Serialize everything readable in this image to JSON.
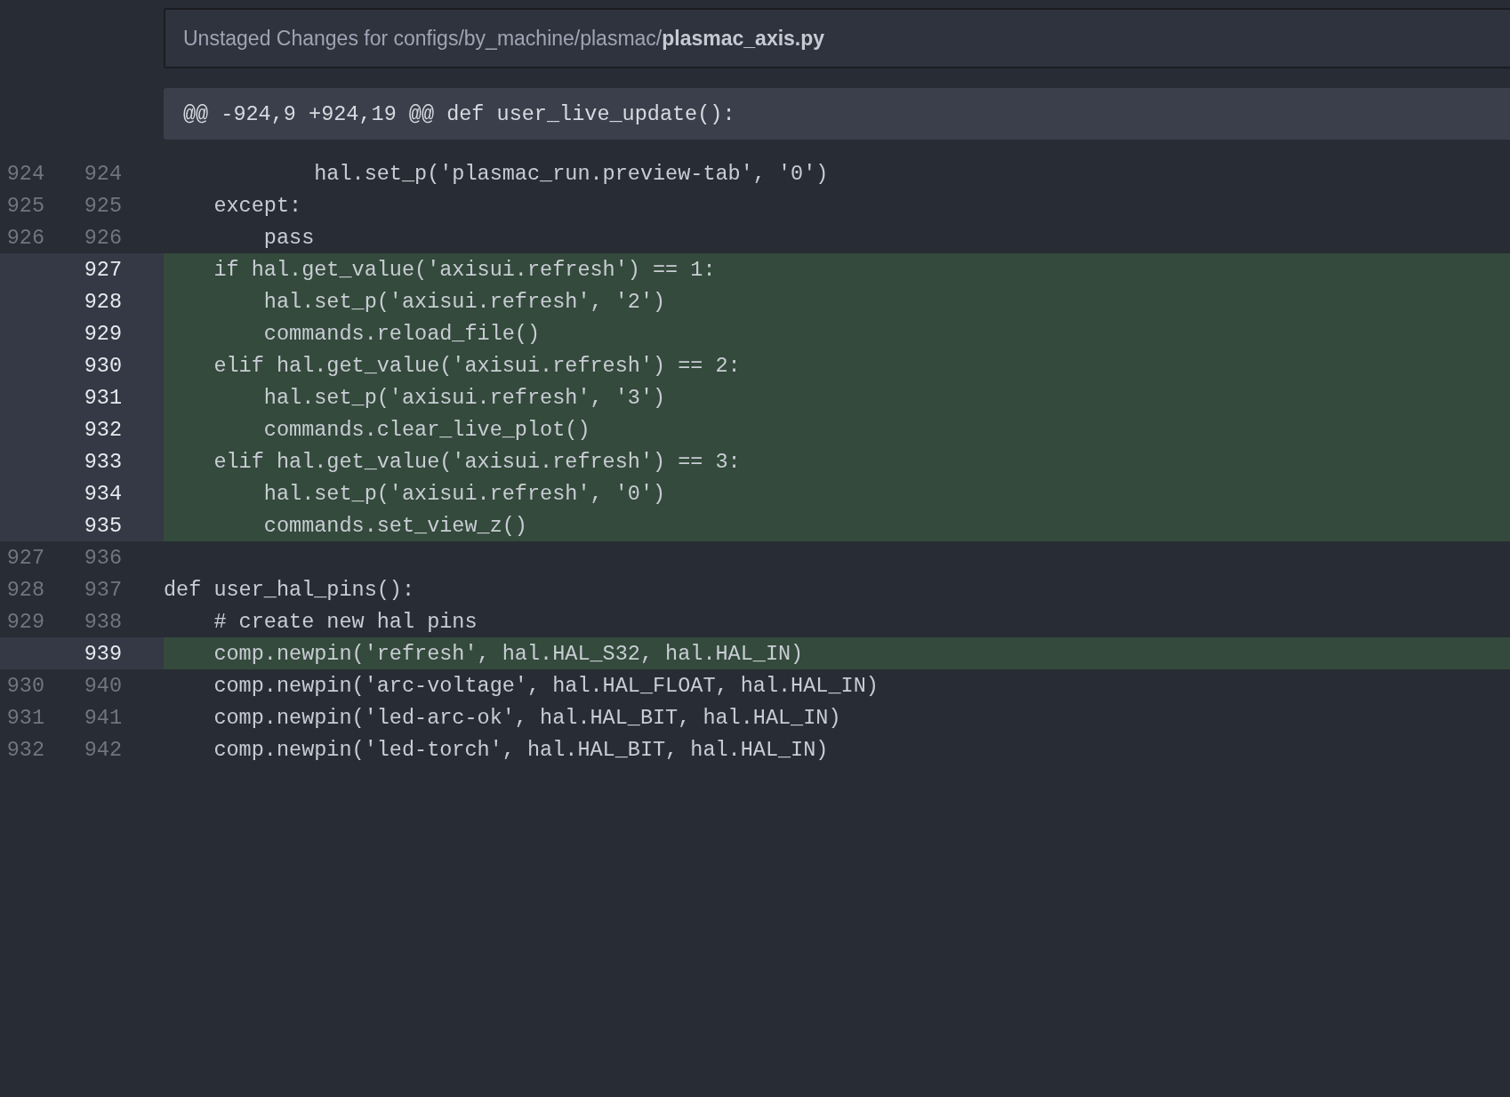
{
  "header": {
    "prefix": "Unstaged Changes for configs/by_machine/plasmac/",
    "filename": "plasmac_axis.py"
  },
  "hunk_header": "@@ -924,9 +924,19 @@ def user_live_update():",
  "lines": [
    {
      "kind": "context",
      "old": "924",
      "new": "924",
      "code": "            hal.set_p('plasmac_run.preview-tab', '0')"
    },
    {
      "kind": "context",
      "old": "925",
      "new": "925",
      "code": "    except:"
    },
    {
      "kind": "context",
      "old": "926",
      "new": "926",
      "code": "        pass"
    },
    {
      "kind": "added",
      "new": "927",
      "code": "    if hal.get_value('axisui.refresh') == 1:"
    },
    {
      "kind": "added",
      "new": "928",
      "code": "        hal.set_p('axisui.refresh', '2')"
    },
    {
      "kind": "added",
      "new": "929",
      "code": "        commands.reload_file()"
    },
    {
      "kind": "added",
      "new": "930",
      "code": "    elif hal.get_value('axisui.refresh') == 2:"
    },
    {
      "kind": "added",
      "new": "931",
      "code": "        hal.set_p('axisui.refresh', '3')"
    },
    {
      "kind": "added",
      "new": "932",
      "code": "        commands.clear_live_plot()"
    },
    {
      "kind": "added",
      "new": "933",
      "code": "    elif hal.get_value('axisui.refresh') == 3:"
    },
    {
      "kind": "added",
      "new": "934",
      "code": "        hal.set_p('axisui.refresh', '0')"
    },
    {
      "kind": "added",
      "new": "935",
      "code": "        commands.set_view_z()"
    },
    {
      "kind": "context",
      "old": "927",
      "new": "936"
    },
    {
      "kind": "context",
      "old": "928",
      "new": "937",
      "code": "def user_hal_pins():"
    },
    {
      "kind": "context",
      "old": "929",
      "new": "938",
      "code": "    # create new hal pins"
    },
    {
      "kind": "added",
      "new": "939",
      "code": "    comp.newpin('refresh', hal.HAL_S32, hal.HAL_IN)"
    },
    {
      "kind": "context",
      "old": "930",
      "new": "940",
      "code": "    comp.newpin('arc-voltage', hal.HAL_FLOAT, hal.HAL_IN)"
    },
    {
      "kind": "context",
      "old": "931",
      "new": "941",
      "code": "    comp.newpin('led-arc-ok', hal.HAL_BIT, hal.HAL_IN)"
    },
    {
      "kind": "context",
      "old": "932",
      "new": "942",
      "code": "    comp.newpin('led-torch', hal.HAL_BIT, hal.HAL_IN)"
    }
  ]
}
